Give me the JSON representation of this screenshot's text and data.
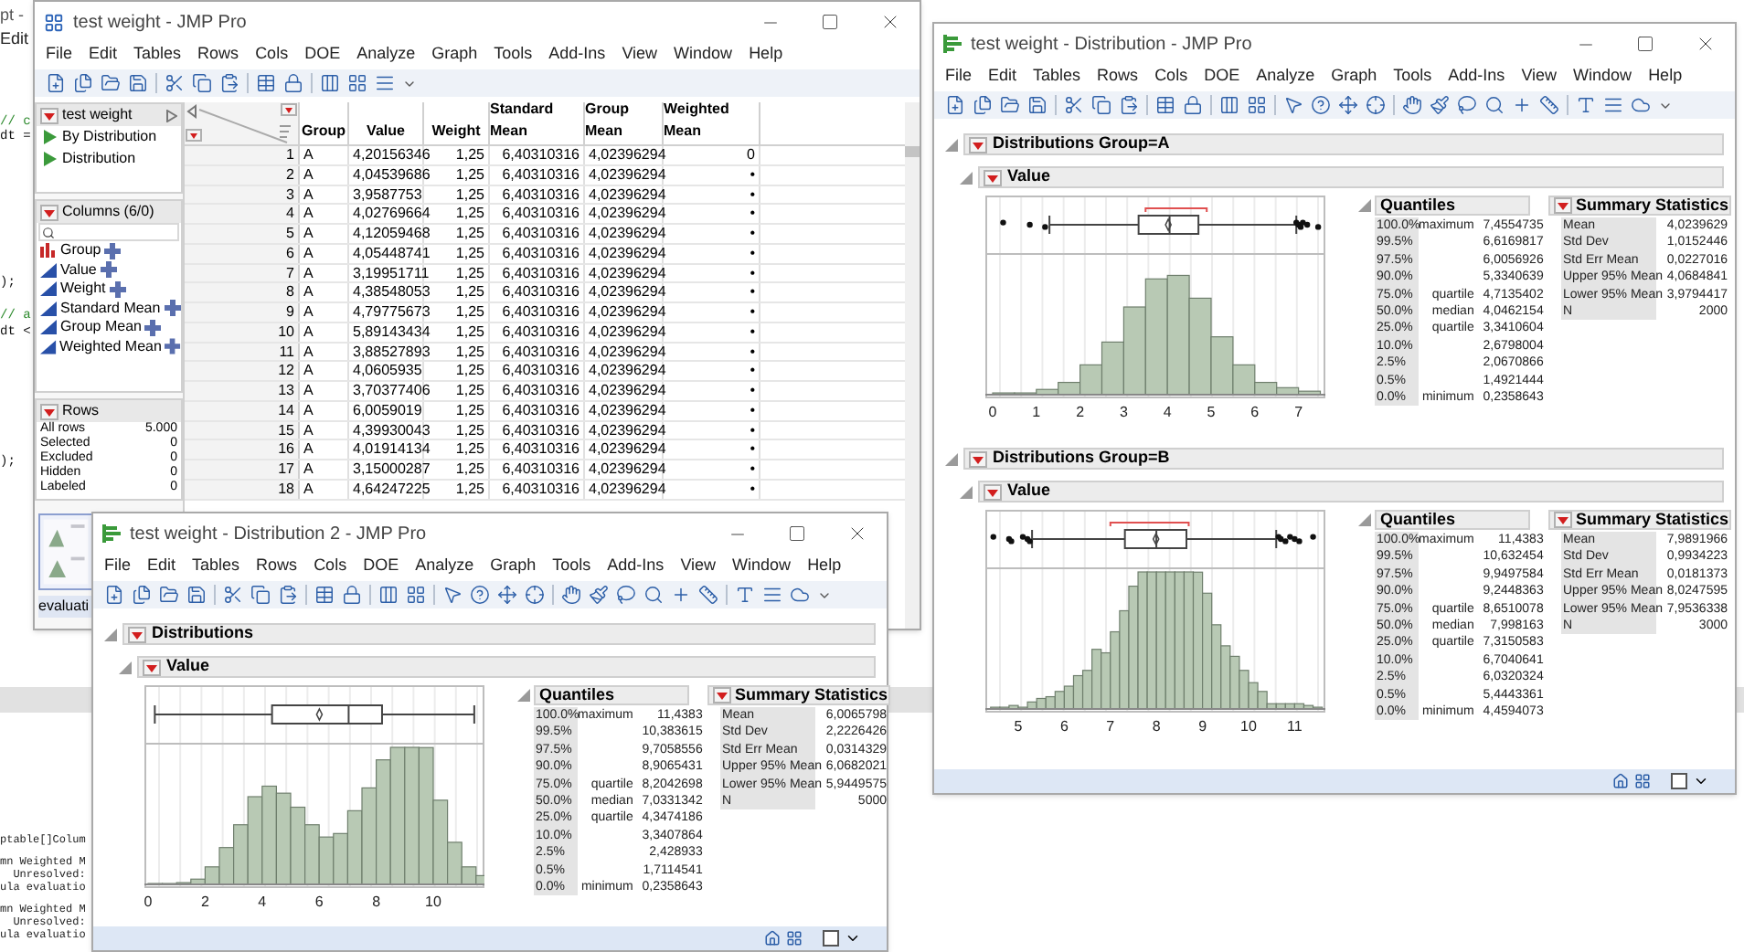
{
  "background_editor": {
    "title": "pt -",
    "menu_item": "Edit",
    "code_lines": [
      {
        "text": "// c",
        "kind": "comment"
      },
      {
        "text": "dt =",
        "kind": "code"
      },
      {
        "text": ");",
        "kind": "code"
      },
      {
        "text": "// a",
        "kind": "comment"
      },
      {
        "text": "dt <",
        "kind": "code"
      },
      {
        "text": ");",
        "kind": "code"
      }
    ],
    "log_lines": [
      "ptable[]Colum",
      "mn Weighted M",
      "  Unresolved:",
      "ula evaluatio",
      "mn Weighted M",
      "  Unresolved:",
      "ula evaluatio"
    ]
  },
  "data_table_window": {
    "title": "test weight - JMP Pro",
    "menu": [
      "File",
      "Edit",
      "Tables",
      "Rows",
      "Cols",
      "DOE",
      "Analyze",
      "Graph",
      "Tools",
      "Add-Ins",
      "View",
      "Window",
      "Help"
    ],
    "table_panel": {
      "name": "test weight",
      "scripts": [
        "By Distribution",
        "Distribution"
      ]
    },
    "columns_panel": {
      "title": "Columns (6/0)",
      "columns": [
        {
          "name": "Group",
          "kind": "nominal"
        },
        {
          "name": "Value",
          "kind": "continuous"
        },
        {
          "name": "Weight",
          "kind": "continuous"
        },
        {
          "name": "Standard Mean",
          "kind": "continuous"
        },
        {
          "name": "Group Mean",
          "kind": "continuous"
        },
        {
          "name": "Weighted Mean",
          "kind": "continuous"
        }
      ]
    },
    "rows_panel": {
      "title": "Rows",
      "stats": [
        {
          "label": "All rows",
          "value": "5.000"
        },
        {
          "label": "Selected",
          "value": "0"
        },
        {
          "label": "Excluded",
          "value": "0"
        },
        {
          "label": "Hidden",
          "value": "0"
        },
        {
          "label": "Labeled",
          "value": "0"
        }
      ]
    },
    "thumbnail_tab": "evaluati",
    "table": {
      "columns": [
        "Group",
        "Value",
        "Weight",
        "Standard Mean",
        "Group Mean",
        "Weighted Mean"
      ],
      "rows": [
        {
          "number": "1",
          "cells": [
            "A",
            "4,20156346",
            "1,25",
            "6,40310316",
            "4,02396294",
            "0"
          ]
        },
        {
          "number": "2",
          "cells": [
            "A",
            "4,04539686",
            "1,25",
            "6,40310316",
            "4,02396294",
            "•"
          ]
        },
        {
          "number": "3",
          "cells": [
            "A",
            "3,9587753",
            "1,25",
            "6,40310316",
            "4,02396294",
            "•"
          ]
        },
        {
          "number": "4",
          "cells": [
            "A",
            "4,02769664",
            "1,25",
            "6,40310316",
            "4,02396294",
            "•"
          ]
        },
        {
          "number": "5",
          "cells": [
            "A",
            "4,12059468",
            "1,25",
            "6,40310316",
            "4,02396294",
            "•"
          ]
        },
        {
          "number": "6",
          "cells": [
            "A",
            "4,05448741",
            "1,25",
            "6,40310316",
            "4,02396294",
            "•"
          ]
        },
        {
          "number": "7",
          "cells": [
            "A",
            "3,19951711",
            "1,25",
            "6,40310316",
            "4,02396294",
            "•"
          ]
        },
        {
          "number": "8",
          "cells": [
            "A",
            "4,38548053",
            "1,25",
            "6,40310316",
            "4,02396294",
            "•"
          ]
        },
        {
          "number": "9",
          "cells": [
            "A",
            "4,79775673",
            "1,25",
            "6,40310316",
            "4,02396294",
            "•"
          ]
        },
        {
          "number": "10",
          "cells": [
            "A",
            "5,89143434",
            "1,25",
            "6,40310316",
            "4,02396294",
            "•"
          ]
        },
        {
          "number": "11",
          "cells": [
            "A",
            "3,88527893",
            "1,25",
            "6,40310316",
            "4,02396294",
            "•"
          ]
        },
        {
          "number": "12",
          "cells": [
            "A",
            "4,0605935",
            "1,25",
            "6,40310316",
            "4,02396294",
            "•"
          ]
        },
        {
          "number": "13",
          "cells": [
            "A",
            "3,70377406",
            "1,25",
            "6,40310316",
            "4,02396294",
            "•"
          ]
        },
        {
          "number": "14",
          "cells": [
            "A",
            "6,0059019",
            "1,25",
            "6,40310316",
            "4,02396294",
            "•"
          ]
        },
        {
          "number": "15",
          "cells": [
            "A",
            "4,39930043",
            "1,25",
            "6,40310316",
            "4,02396294",
            "•"
          ]
        },
        {
          "number": "16",
          "cells": [
            "A",
            "4,01914134",
            "1,25",
            "6,40310316",
            "4,02396294",
            "•"
          ]
        },
        {
          "number": "17",
          "cells": [
            "A",
            "3,15000287",
            "1,25",
            "6,40310316",
            "4,02396294",
            "•"
          ]
        },
        {
          "number": "18",
          "cells": [
            "A",
            "4,64247225",
            "1,25",
            "6,40310316",
            "4,02396294",
            "•"
          ]
        }
      ]
    }
  },
  "distribution_window": {
    "title": "test weight - Distribution - JMP Pro",
    "menu": [
      "File",
      "Edit",
      "Tables",
      "Rows",
      "Cols",
      "DOE",
      "Analyze",
      "Graph",
      "Tools",
      "Add-Ins",
      "View",
      "Window",
      "Help"
    ],
    "reports": [
      {
        "title": "Distributions Group=A",
        "variable": "Value",
        "axis_labels": [
          "0",
          "1",
          "2",
          "3",
          "4",
          "5",
          "6",
          "7"
        ],
        "quantiles_title": "Quantiles",
        "quantiles": [
          {
            "percent": "100.0%",
            "label": "maximum",
            "value": "7,4554735"
          },
          {
            "percent": "99.5%",
            "value": "6,6169817"
          },
          {
            "percent": "97.5%",
            "value": "6,0056926"
          },
          {
            "percent": "90.0%",
            "value": "5,3340639"
          },
          {
            "percent": "75.0%",
            "label": "quartile",
            "value": "4,7135402"
          },
          {
            "percent": "50.0%",
            "label": "median",
            "value": "4,0462154"
          },
          {
            "percent": "25.0%",
            "label": "quartile",
            "value": "3,3410604"
          },
          {
            "percent": "10.0%",
            "value": "2,6798004"
          },
          {
            "percent": "2.5%",
            "value": "2,0670866"
          },
          {
            "percent": "0.5%",
            "value": "1,4921444"
          },
          {
            "percent": "0.0%",
            "label": "minimum",
            "value": "0,2358643"
          }
        ],
        "summary_title": "Summary Statistics",
        "summary": [
          {
            "label": "Mean",
            "value": "4,0239629"
          },
          {
            "label": "Std Dev",
            "value": "1,0152446"
          },
          {
            "label": "Std Err Mean",
            "value": "0,0227016"
          },
          {
            "label": "Upper 95% Mean",
            "value": "4,0684841"
          },
          {
            "label": "Lower 95% Mean",
            "value": "3,9794417"
          },
          {
            "label": "N",
            "value": "2000"
          }
        ]
      },
      {
        "title": "Distributions Group=B",
        "variable": "Value",
        "axis_labels": [
          "5",
          "6",
          "7",
          "8",
          "9",
          "10",
          "11"
        ],
        "quantiles_title": "Quantiles",
        "quantiles": [
          {
            "percent": "100.0%",
            "label": "maximum",
            "value": "11,4383"
          },
          {
            "percent": "99.5%",
            "value": "10,632454"
          },
          {
            "percent": "97.5%",
            "value": "9,9497584"
          },
          {
            "percent": "90.0%",
            "value": "9,2448363"
          },
          {
            "percent": "75.0%",
            "label": "quartile",
            "value": "8,6510078"
          },
          {
            "percent": "50.0%",
            "label": "median",
            "value": "7,998163"
          },
          {
            "percent": "25.0%",
            "label": "quartile",
            "value": "7,3150583"
          },
          {
            "percent": "10.0%",
            "value": "6,7040641"
          },
          {
            "percent": "2.5%",
            "value": "6,0320324"
          },
          {
            "percent": "0.5%",
            "value": "5,4443361"
          },
          {
            "percent": "0.0%",
            "label": "minimum",
            "value": "4,4594073"
          }
        ],
        "summary_title": "Summary Statistics",
        "summary": [
          {
            "label": "Mean",
            "value": "7,9891966"
          },
          {
            "label": "Std Dev",
            "value": "0,9934223"
          },
          {
            "label": "Std Err Mean",
            "value": "0,0181373"
          },
          {
            "label": "Upper 95% Mean",
            "value": "8,0247595"
          },
          {
            "label": "Lower 95% Mean",
            "value": "7,9536338"
          },
          {
            "label": "N",
            "value": "3000"
          }
        ]
      }
    ]
  },
  "distribution_2_window": {
    "title": "test weight - Distribution 2 - JMP Pro",
    "menu": [
      "File",
      "Edit",
      "Tables",
      "Rows",
      "Cols",
      "DOE",
      "Analyze",
      "Graph",
      "Tools",
      "Add-Ins",
      "View",
      "Window",
      "Help"
    ],
    "reports": [
      {
        "title": "Distributions",
        "variable": "Value",
        "axis_labels": [
          "0",
          "2",
          "4",
          "6",
          "8",
          "10"
        ],
        "quantiles_title": "Quantiles",
        "quantiles": [
          {
            "percent": "100.0%",
            "label": "maximum",
            "value": "11,4383"
          },
          {
            "percent": "99.5%",
            "value": "10,383615"
          },
          {
            "percent": "97.5%",
            "value": "9,7058556"
          },
          {
            "percent": "90.0%",
            "value": "8,9065431"
          },
          {
            "percent": "75.0%",
            "label": "quartile",
            "value": "8,2042698"
          },
          {
            "percent": "50.0%",
            "label": "median",
            "value": "7,0331342"
          },
          {
            "percent": "25.0%",
            "label": "quartile",
            "value": "4,3474186"
          },
          {
            "percent": "10.0%",
            "value": "3,3407864"
          },
          {
            "percent": "2.5%",
            "value": "2,428933"
          },
          {
            "percent": "0.5%",
            "value": "1,7114541"
          },
          {
            "percent": "0.0%",
            "label": "minimum",
            "value": "0,2358643"
          }
        ],
        "summary_title": "Summary Statistics",
        "summary": [
          {
            "label": "Mean",
            "value": "6,0065798"
          },
          {
            "label": "Std Dev",
            "value": "2,2226426"
          },
          {
            "label": "Std Err Mean",
            "value": "0,0314329"
          },
          {
            "label": "Upper 95% Mean",
            "value": "6,0682021"
          },
          {
            "label": "Lower 95% Mean",
            "value": "5,9449575"
          },
          {
            "label": "N",
            "value": "5000"
          }
        ]
      }
    ]
  }
}
